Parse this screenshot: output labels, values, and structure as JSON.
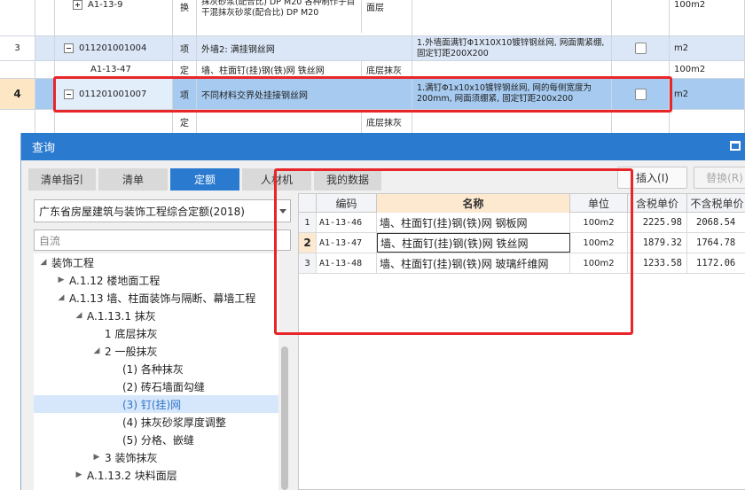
{
  "grid": {
    "rows": [
      {
        "num": "",
        "expand": "plus",
        "code": "A1-13-9",
        "type": "换",
        "name": "抹灰砂浆(配合比) DP M20  各种制作子目 干混抹灰砂浆(配合比) DP M20",
        "desc": "面层",
        "unit": "100m2",
        "checkbox": false
      },
      {
        "num": "3",
        "expand": "minus",
        "code": "011201001004",
        "type": "项",
        "name": "外墙2: 满挂钢丝网",
        "desc": "1.外墙面满钉Φ1X10X10镀锌钢丝网, 网面需紧绷, 固定钉距200X200",
        "unit": "m2",
        "checkbox": true
      },
      {
        "num": "",
        "expand": "",
        "code": "A1-13-47",
        "type": "定",
        "name": "墙、柱面钉(挂)钢(铁)网 铁丝网",
        "desc": "底层抹灰",
        "unit": "100m2",
        "checkbox": false
      },
      {
        "num": "4",
        "expand": "minus",
        "code": "011201001007",
        "type": "项",
        "name": "不同材料交界处挂接钢丝网",
        "desc": "1.满钉Φ1x10x10镀锌钢丝网, 网的每侧宽度为200mm, 网面须绷紧, 固定钉距200x200",
        "unit": "m2",
        "checkbox": true
      },
      {
        "num": "",
        "expand": "",
        "code": "",
        "type": "定",
        "name": "",
        "desc": "底层抹灰",
        "unit": "",
        "checkbox": false
      }
    ]
  },
  "dialog": {
    "title": "查询",
    "tabs": [
      {
        "label": "清单指引",
        "active": false
      },
      {
        "label": "清单",
        "active": false
      },
      {
        "label": "定额",
        "active": true
      },
      {
        "label": "人材机",
        "active": false
      },
      {
        "label": "我的数据",
        "active": false
      }
    ],
    "insert_button": "插入(I)",
    "replace_button": "替换(R)",
    "quota_library": "广东省房屋建筑与装饰工程综合定额(2018)",
    "search_placeholder": "自流",
    "tree": [
      {
        "label": "装饰工程",
        "arrow": "down",
        "selected": false
      },
      {
        "label": "A.1.12 楼地面工程",
        "arrow": "right",
        "selected": false
      },
      {
        "label": "A.1.13 墙、柱面装饰与隔断、幕墙工程",
        "arrow": "down",
        "selected": false
      },
      {
        "label": "A.1.13.1 抹灰",
        "arrow": "down",
        "selected": false
      },
      {
        "label": "1 底层抹灰",
        "arrow": "",
        "selected": false
      },
      {
        "label": "2 一般抹灰",
        "arrow": "down",
        "selected": false
      },
      {
        "label": "(1) 各种抹灰",
        "arrow": "",
        "selected": false
      },
      {
        "label": "(2) 砖石墙面勾缝",
        "arrow": "",
        "selected": false
      },
      {
        "label": "(3) 钉(挂)网",
        "arrow": "",
        "selected": true
      },
      {
        "label": "(4) 抹灰砂浆厚度调整",
        "arrow": "",
        "selected": false
      },
      {
        "label": "(5) 分格、嵌缝",
        "arrow": "",
        "selected": false
      },
      {
        "label": "3 装饰抹灰",
        "arrow": "right",
        "selected": false
      },
      {
        "label": "A.1.13.2 块料面层",
        "arrow": "right",
        "selected": false
      }
    ],
    "table": {
      "headers": [
        "编码",
        "名称",
        "单位",
        "含税单价",
        "不含税单价"
      ],
      "rows": [
        {
          "idx": "1",
          "code": "A1-13-46",
          "name": "墙、柱面钉(挂)钢(铁)网 钢板网",
          "unit": "100m2",
          "price_tax": "2225.98",
          "price_notax": "2068.54"
        },
        {
          "idx": "2",
          "code": "A1-13-47",
          "name": "墙、柱面钉(挂)钢(铁)网 铁丝网",
          "unit": "100m2",
          "price_tax": "1879.32",
          "price_notax": "1764.78"
        },
        {
          "idx": "3",
          "code": "A1-13-48",
          "name": "墙、柱面钉(挂)钢(铁)网 玻璃纤维网",
          "unit": "100m2",
          "price_tax": "1233.58",
          "price_notax": "1172.06"
        }
      ]
    }
  },
  "colors": {
    "accent": "#2a7ad0",
    "annotation_red": "#e8262a",
    "selected_row": "#a6caf0",
    "highlight_row": "#dbe7f7"
  }
}
